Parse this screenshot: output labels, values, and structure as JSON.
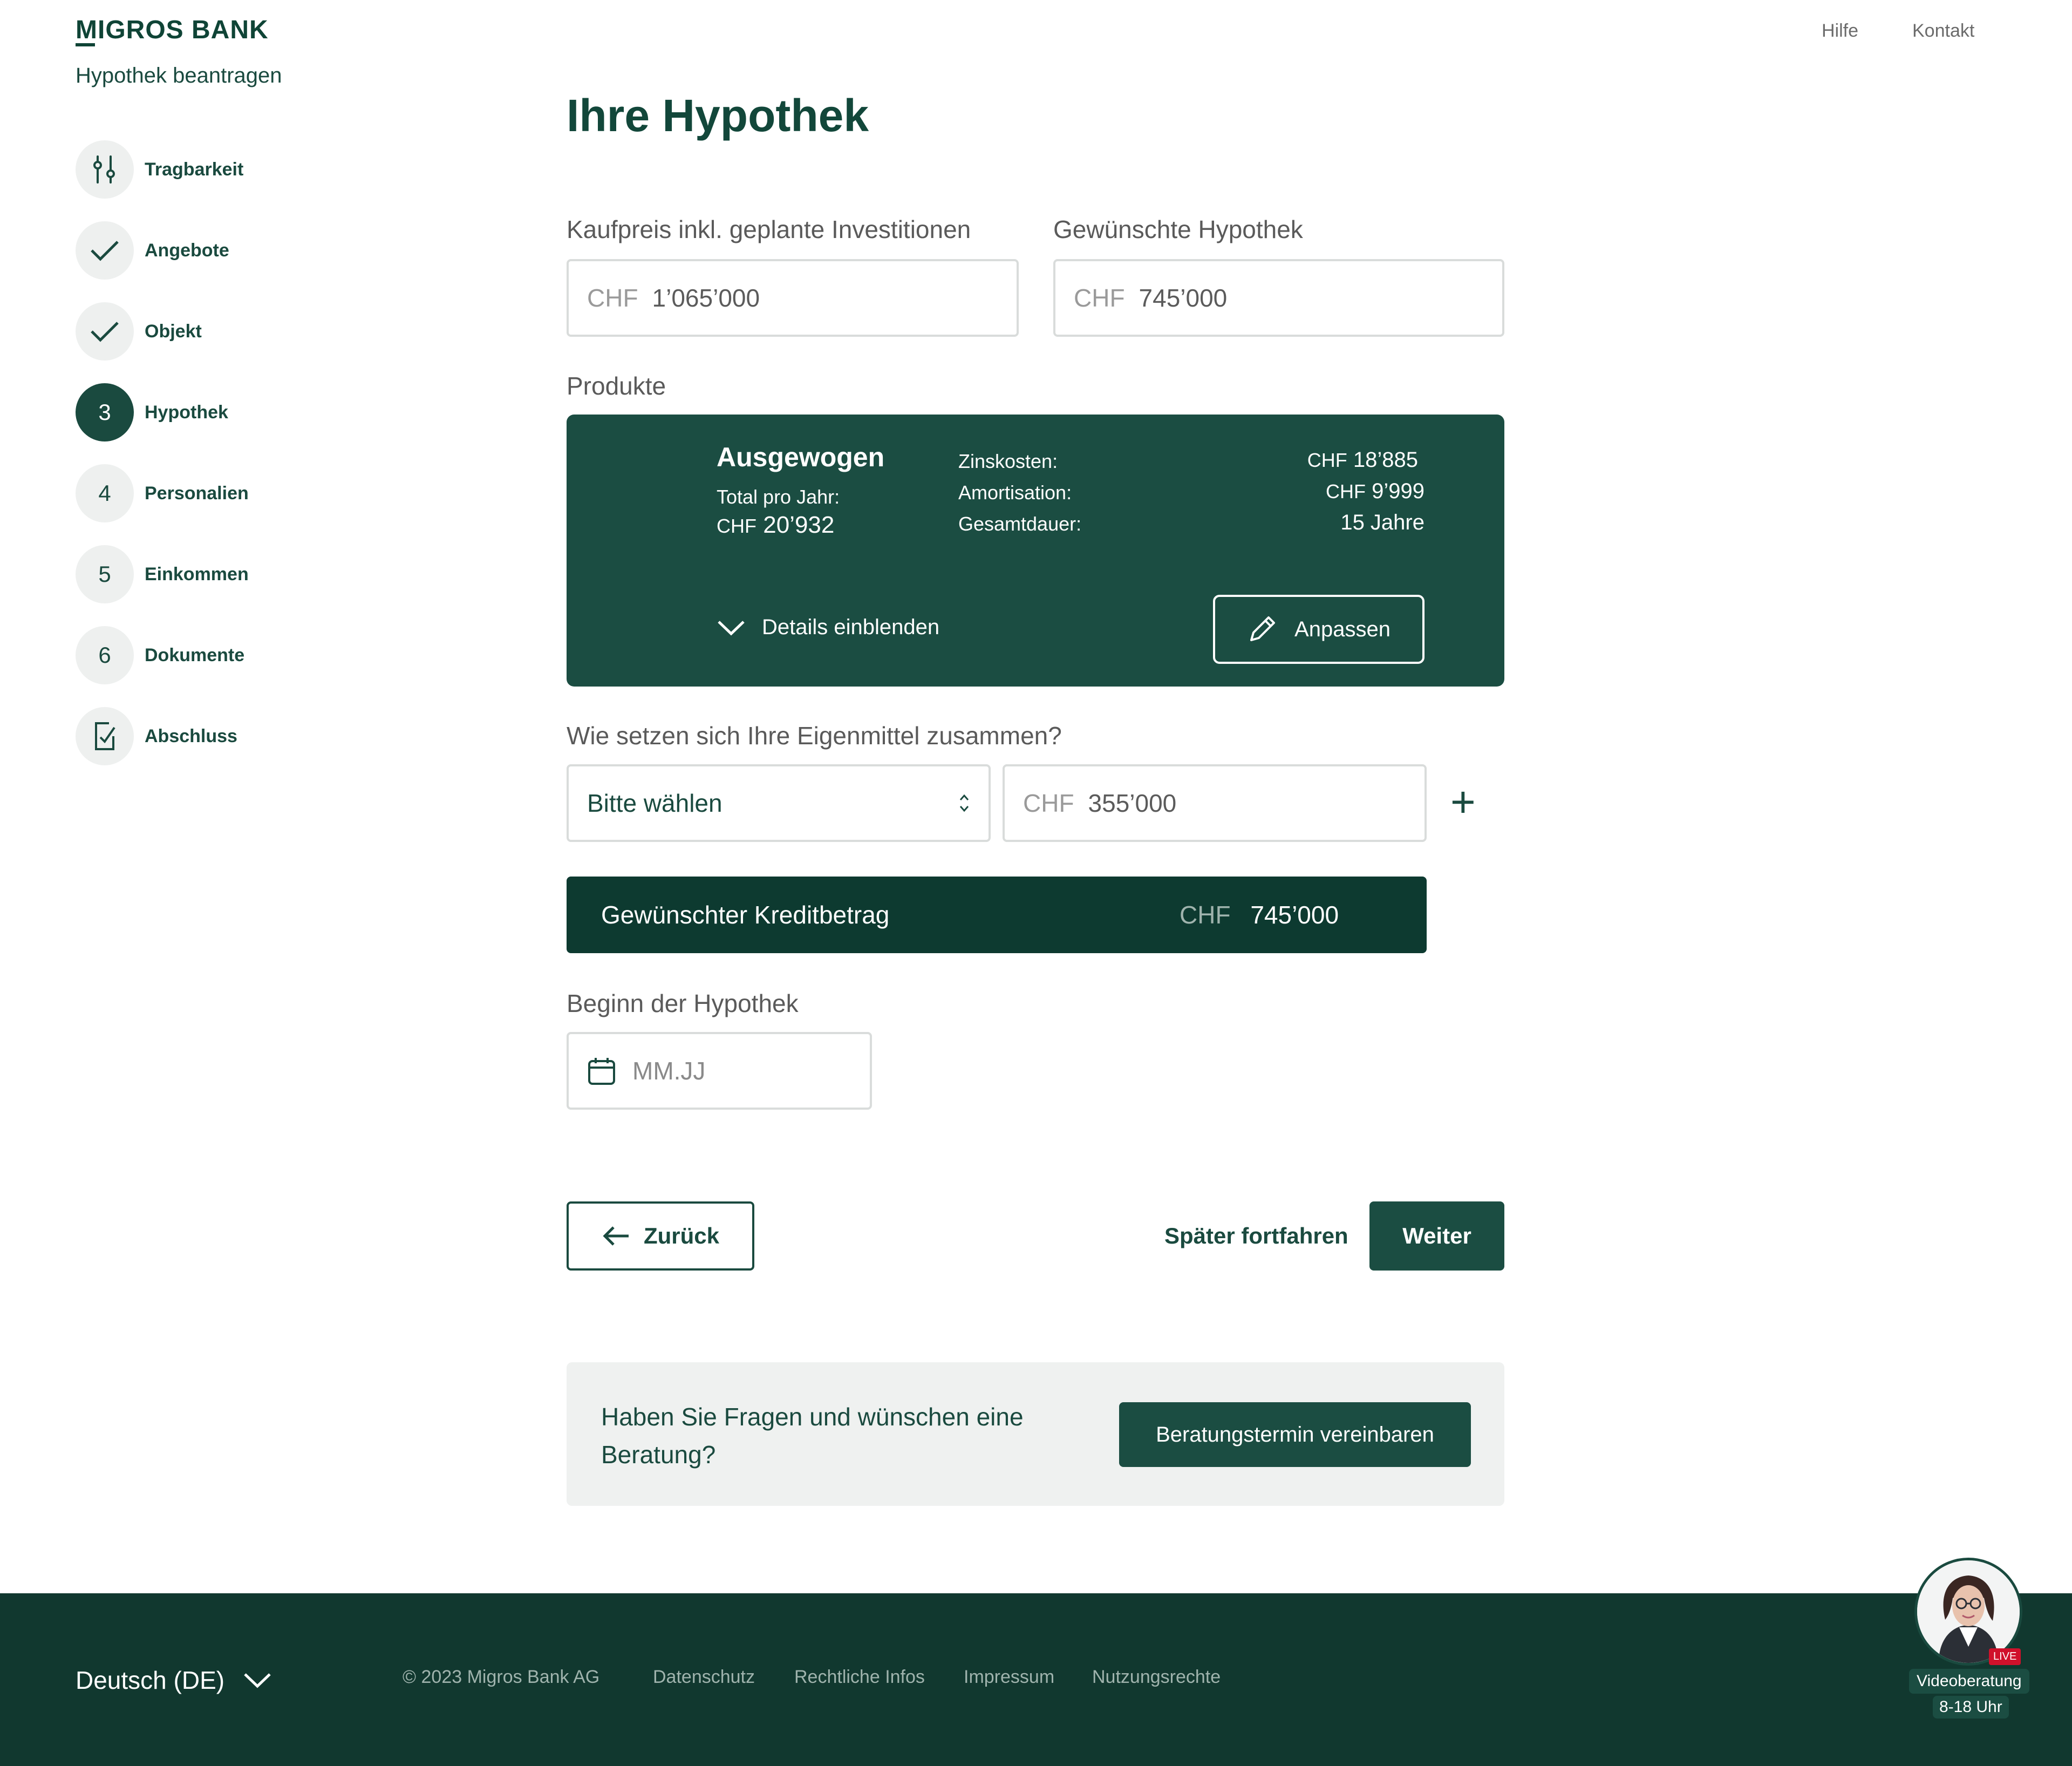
{
  "header": {
    "logo": "MIGROS BANK",
    "app_title": "Hypothek beantragen",
    "links": [
      "Hilfe",
      "Kontakt"
    ]
  },
  "steps": [
    {
      "marker": "",
      "icon": "sliders-icon",
      "label": "Tragbarkeit",
      "state": "done"
    },
    {
      "marker": "",
      "icon": "check-icon",
      "label": "Angebote",
      "state": "done"
    },
    {
      "marker": "",
      "icon": "check-icon",
      "label": "Objekt",
      "state": "done"
    },
    {
      "marker": "3",
      "label": "Hypothek",
      "state": "active"
    },
    {
      "marker": "4",
      "label": "Personalien",
      "state": "todo"
    },
    {
      "marker": "5",
      "label": "Einkommen",
      "state": "todo"
    },
    {
      "marker": "6",
      "label": "Dokumente",
      "state": "todo"
    },
    {
      "marker": "",
      "icon": "document-check-icon",
      "label": "Abschluss",
      "state": "todo"
    }
  ],
  "main": {
    "title": "Ihre Hypothek",
    "kaufpreis": {
      "label": "Kaufpreis inkl. geplante Investitionen",
      "currency": "CHF",
      "value": "1’065’000"
    },
    "hypothek": {
      "label": "Gewünschte Hypothek",
      "currency": "CHF",
      "value": "745’000"
    },
    "produkte_label": "Produkte",
    "product": {
      "name": "Ausgewogen",
      "total_label": "Total pro Jahr:",
      "total_currency": "CHF",
      "total_value": "20’932",
      "rows": [
        {
          "label": "Zinskosten:",
          "currency": "CHF",
          "value": "18’885"
        },
        {
          "label": "Amortisation:",
          "currency": "CHF",
          "value": "9’999"
        },
        {
          "label": "Gesamtdauer:",
          "currency": "",
          "value": "15 Jahre"
        }
      ],
      "details_toggle": "Details einblenden",
      "adjust_button": "Anpassen"
    },
    "eigenmittel": {
      "label": "Wie setzen sich Ihre Eigenmittel zusammen?",
      "select_value": "Bitte wählen",
      "currency": "CHF",
      "amount": "355’000",
      "add": "+"
    },
    "credit": {
      "label": "Gewünschter Kreditbetrag",
      "currency": "CHF",
      "value": "745’000"
    },
    "start": {
      "label": "Beginn der Hypothek",
      "placeholder": "MM.JJ"
    },
    "buttons": {
      "back": "Zurück",
      "later": "Später fortfahren",
      "next": "Weiter"
    },
    "help": {
      "text": "Haben Sie Fragen und wünschen eine Beratung?",
      "button": "Beratungstermin vereinbaren"
    }
  },
  "footer": {
    "language": "Deutsch (DE)",
    "copyright": "© 2023 Migros Bank AG",
    "links": [
      "Datenschutz",
      "Rechtliche Infos",
      "Impressum",
      "Nutzungsrechte"
    ]
  },
  "video": {
    "badge": "LIVE",
    "label": "Videoberatung",
    "hours": "8-18 Uhr"
  },
  "colors": {
    "primary": "#1b4d42",
    "dark": "#0d3a30",
    "footer": "#11382f",
    "live": "#d0112b"
  }
}
